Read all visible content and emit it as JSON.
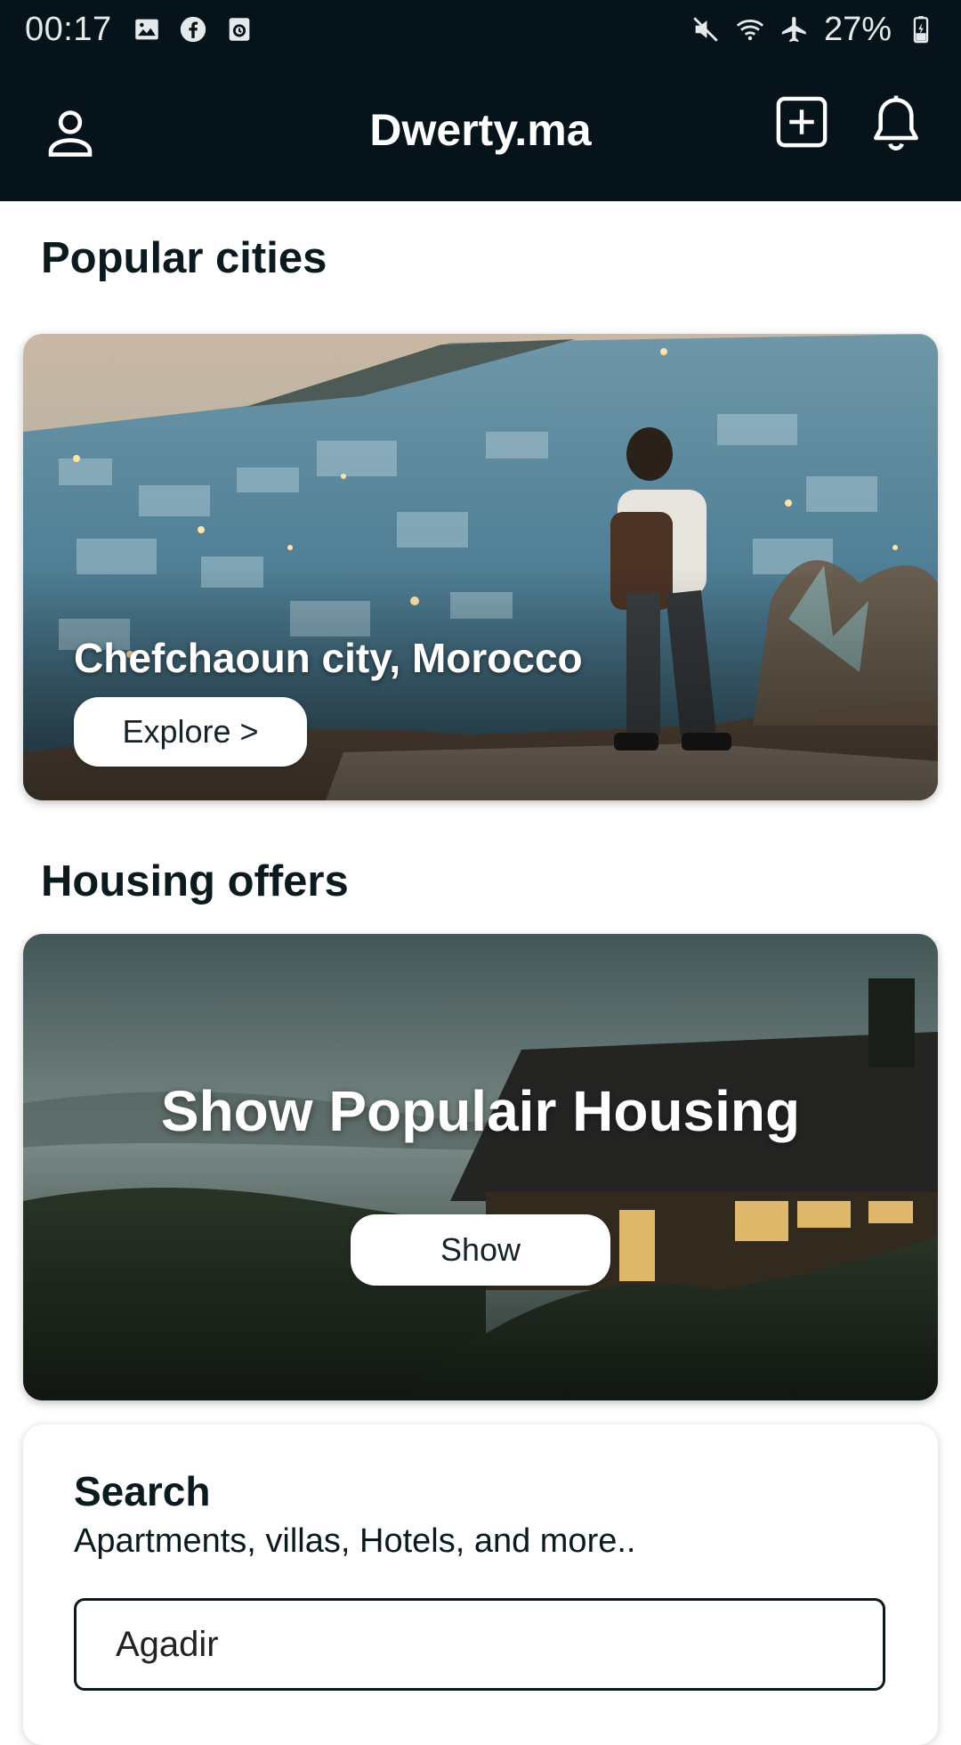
{
  "status_bar": {
    "time": "00:17",
    "battery": "27%",
    "left_icons": [
      "image-icon",
      "facebook-icon",
      "calendar-icon"
    ],
    "right_icons": [
      "mute-icon",
      "wifi-icon",
      "airplane-icon",
      "battery-charging-icon"
    ]
  },
  "app_bar": {
    "title": "Dwerty.ma",
    "icons": [
      "profile-icon",
      "add-box-icon",
      "bell-icon"
    ],
    "background": "#06131a"
  },
  "popular": {
    "section_title": "Popular cities",
    "city_name": "Chefchaoun city, Morocco",
    "explore_label": "Explore >"
  },
  "housing": {
    "section_title": "Housing offers",
    "headline": "Show Populair Housing",
    "show_label": "Show"
  },
  "search": {
    "title": "Search",
    "subtitle": "Apartments, villas, Hotels, and more..",
    "input_value": "Agadir"
  }
}
